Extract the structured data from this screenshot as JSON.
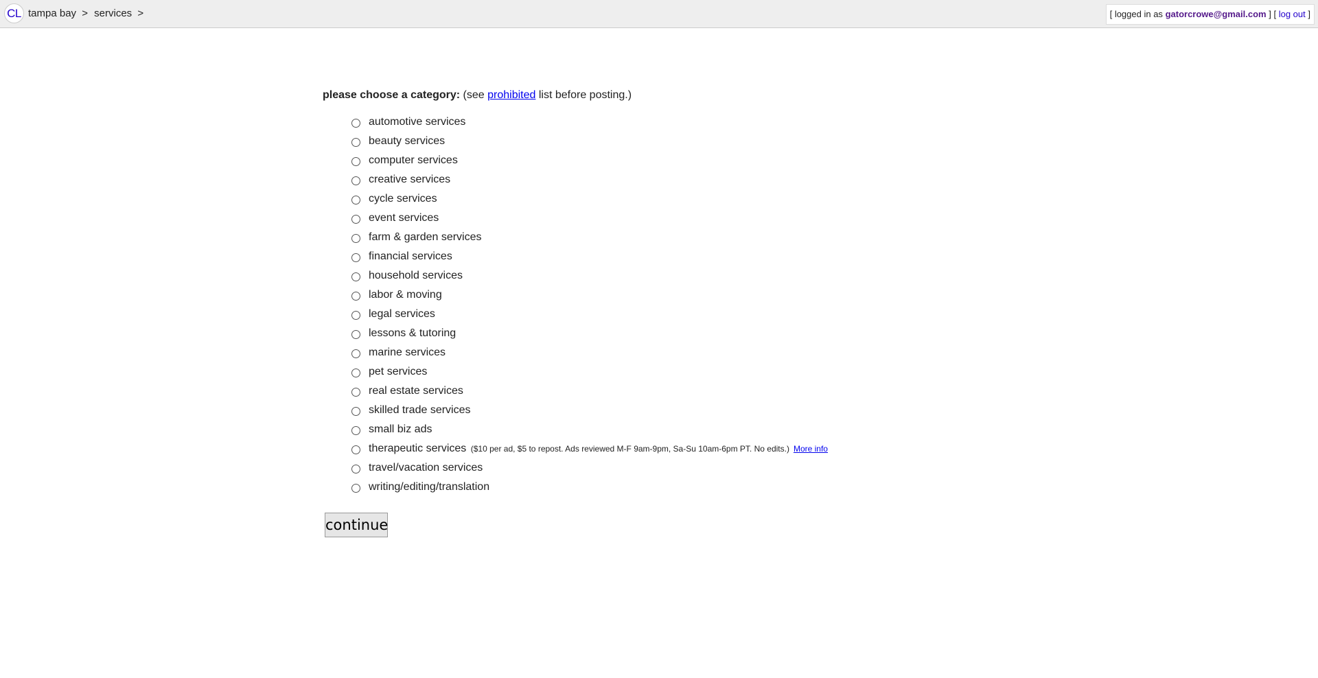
{
  "header": {
    "logo": "CL",
    "breadcrumb": [
      "tampa bay",
      "services"
    ],
    "separator": ">",
    "user": {
      "prefix": "[ logged in as",
      "email": "gatorcrowe@gmail.com",
      "mid": "] [",
      "logout": "log out",
      "suffix": "]"
    }
  },
  "main": {
    "heading_bold": "please choose a category:",
    "heading_pre": "(see",
    "heading_link": "prohibited",
    "heading_post": "list before posting.)",
    "categories": [
      "automotive services",
      "beauty services",
      "computer services",
      "creative services",
      "cycle services",
      "event services",
      "farm & garden services",
      "financial services",
      "household services",
      "labor & moving",
      "legal services",
      "lessons & tutoring",
      "marine services",
      "pet services",
      "real estate services",
      "skilled trade services",
      "small biz ads",
      "therapeutic services",
      "travel/vacation services",
      "writing/editing/translation"
    ],
    "therapeutic_note": "($10 per ad, $5 to repost. Ads reviewed M-F 9am-9pm, Sa-Su 10am-6pm PT. No edits.)",
    "therapeutic_more": "More info",
    "continue_label": "continue"
  }
}
